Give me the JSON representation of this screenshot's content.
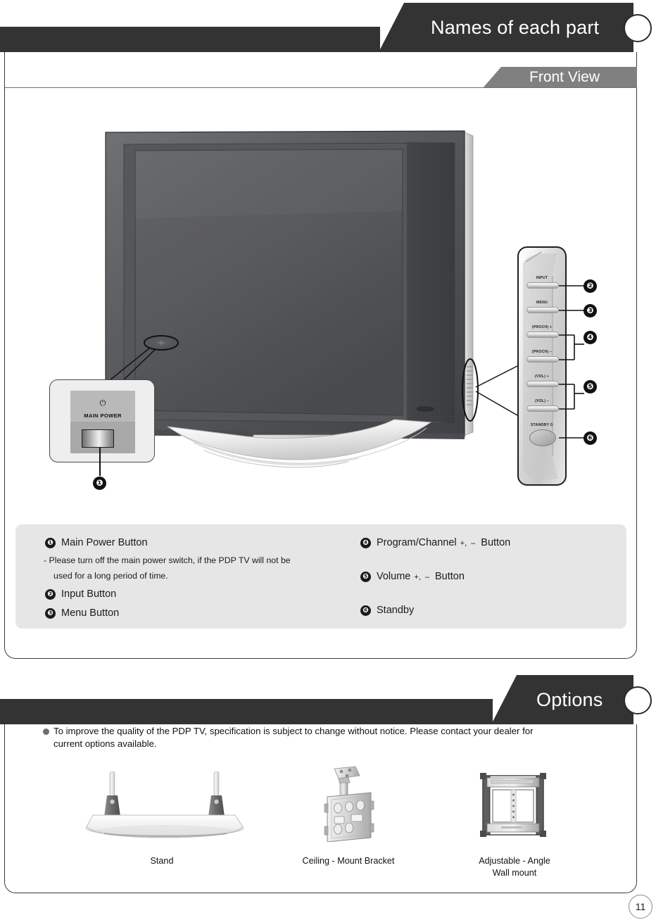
{
  "page": {
    "number": "11"
  },
  "sections": [
    {
      "title": "Names of each part",
      "subsection": {
        "title": "Front View"
      }
    },
    {
      "title": "Options"
    }
  ],
  "header": {
    "chapter_title": "Names of each part",
    "sub_title": "Front View"
  },
  "legend": {
    "left": [
      {
        "num": "❶",
        "label": "Main Power Button"
      },
      {
        "num": "❷",
        "label": "Input  Button"
      },
      {
        "num": "❸",
        "label": "Menu Button"
      }
    ],
    "note_line1": "- Please turn off the main power switch, if the PDP TV will not be",
    "note_line2": "used for a long period of time.",
    "right": [
      {
        "num": "❹",
        "label_pre": "Program/Channel",
        "plus": "+",
        "comma": ",",
        "minus": "–",
        "label_post": "Button"
      },
      {
        "num": "❺",
        "label_pre": "Volume",
        "plus": "+",
        "comma": ",",
        "minus": "–",
        "label_post": "Button"
      },
      {
        "num": "❻",
        "label_pre": "Standby",
        "plus": "",
        "comma": "",
        "minus": "",
        "label_post": ""
      }
    ]
  },
  "tv": {
    "main_power": {
      "symbol": "⏻",
      "label": "MAIN POWER",
      "callout_num": "❶"
    },
    "control_panel": {
      "buttons": [
        {
          "label": "INPUT",
          "callout": "❷"
        },
        {
          "label": "MENU",
          "callout": "❸"
        },
        {
          "label": "(PROCH) +",
          "callout": "❹"
        },
        {
          "label": "(PROCH) –",
          "callout": ""
        },
        {
          "label": "(VOL) +",
          "callout": "❺"
        },
        {
          "label": "(VOL) –",
          "callout": ""
        },
        {
          "label": "STANDBY ⏻",
          "callout": "❻"
        }
      ]
    }
  },
  "options": {
    "title": "Options",
    "notice_line1": "To improve the quality of the PDP TV, specification is subject to change without notice. Please contact your dealer for",
    "notice_line2": "current options available.",
    "items": [
      {
        "caption_line1": "Stand",
        "caption_line2": ""
      },
      {
        "caption_line1": "Ceiling - Mount Bracket",
        "caption_line2": ""
      },
      {
        "caption_line1": "Adjustable - Angle",
        "caption_line2": "Wall mount"
      }
    ]
  },
  "colors": {
    "banner_dark": "#333333",
    "subbanner_gray": "#808080",
    "legend_bg": "#e6e6e6",
    "text_dark": "#111111"
  }
}
